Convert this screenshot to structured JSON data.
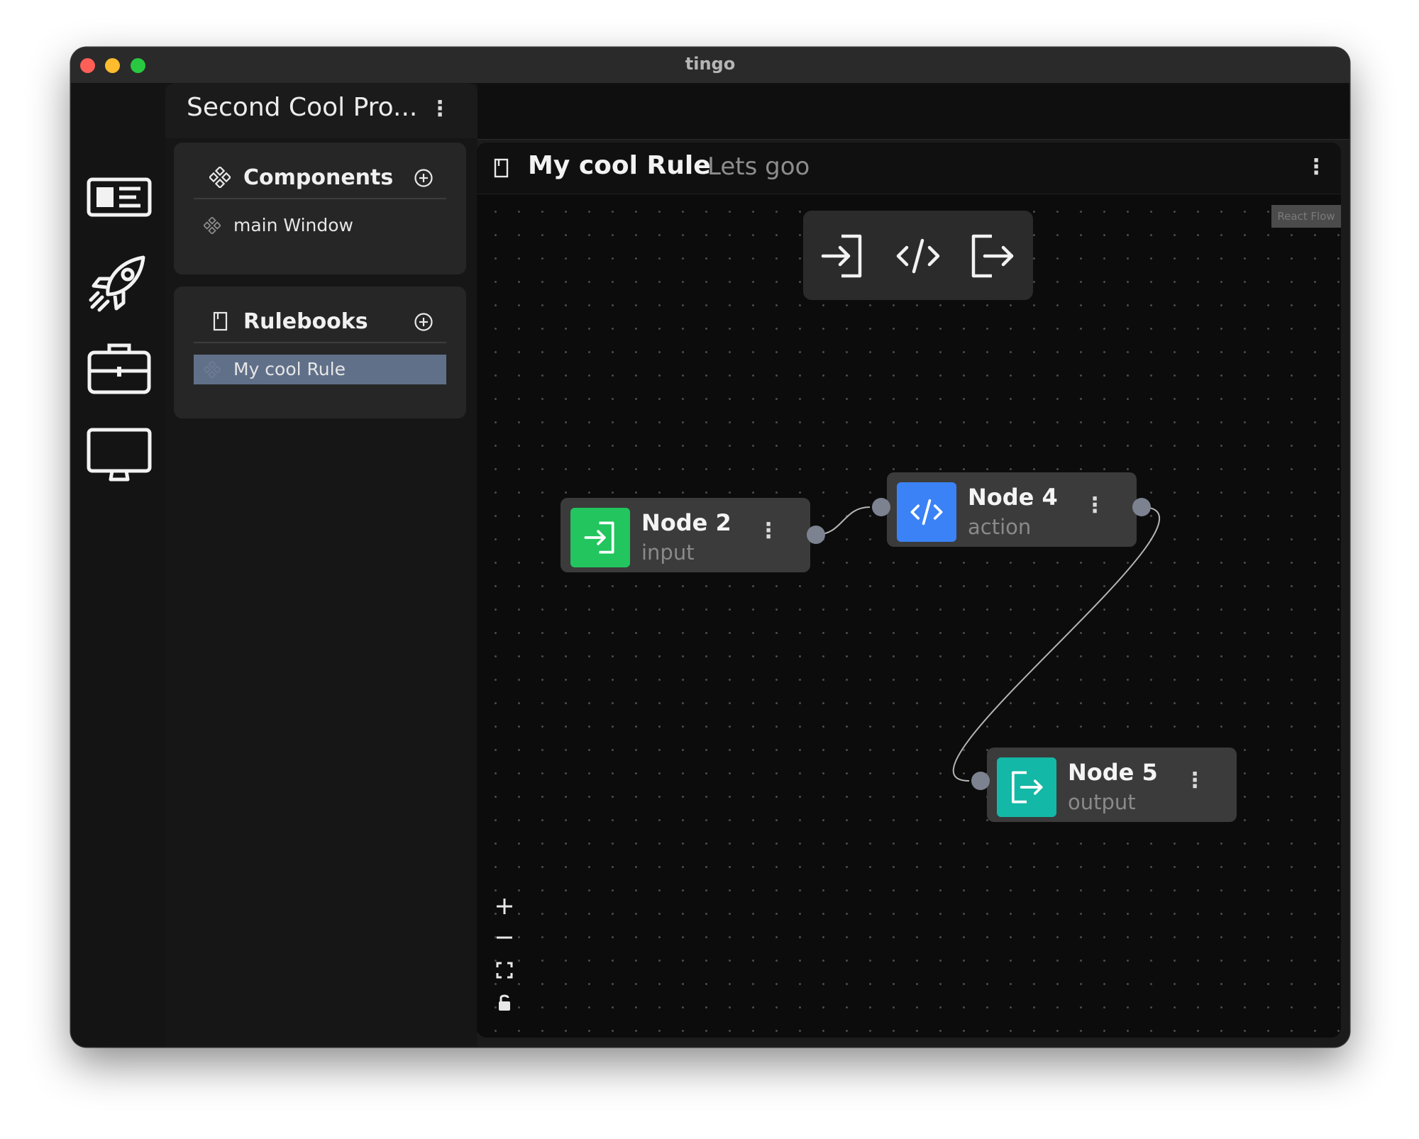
{
  "window": {
    "title": "tingo"
  },
  "project": {
    "title": "Second Cool Pro..."
  },
  "components": {
    "title": "Components",
    "items": [
      {
        "label": "main Window"
      }
    ]
  },
  "rulebooks": {
    "title": "Rulebooks",
    "items": [
      {
        "label": "My cool Rule",
        "active": true
      }
    ]
  },
  "rule": {
    "title": "My cool Rule",
    "subtitle": "Lets goo"
  },
  "flow": {
    "attribution": "React Flow",
    "nodes": [
      {
        "title": "Node 2",
        "type": "input",
        "color": "#22c55e",
        "icon": "login-icon"
      },
      {
        "title": "Node 4",
        "type": "action",
        "color": "#3b82f6",
        "icon": "code-icon"
      },
      {
        "title": "Node 5",
        "type": "output",
        "color": "#14b8a6",
        "icon": "logout-icon"
      }
    ]
  },
  "rail": {
    "icons": [
      "layout-icon",
      "rocket-icon",
      "briefcase-icon",
      "monitor-icon"
    ]
  }
}
